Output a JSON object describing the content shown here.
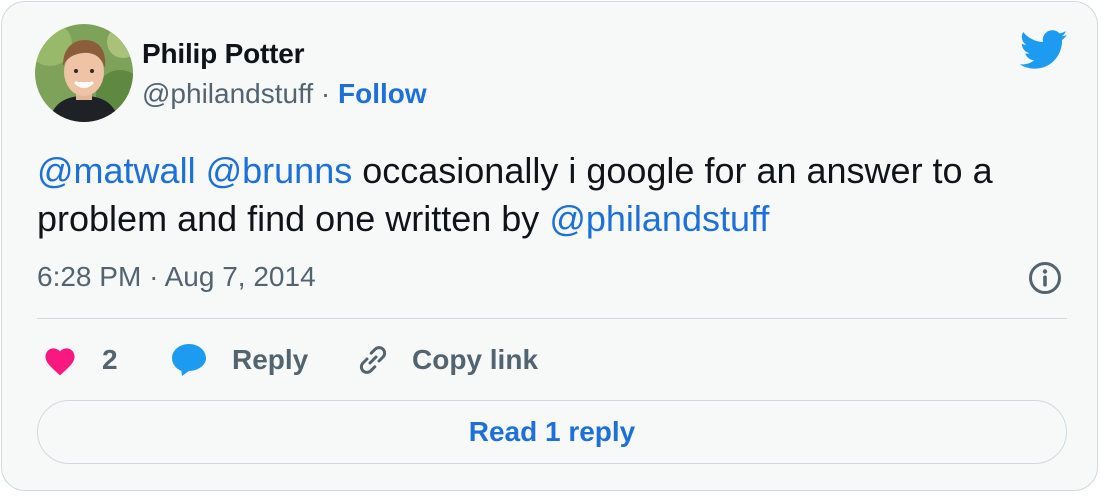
{
  "author": {
    "name": "Philip Potter",
    "handle": "@philandstuff",
    "separator": "·",
    "follow_label": "Follow"
  },
  "tweet": {
    "mention_1": "@matwall",
    "mention_2": "@brunns",
    "text_part_1": "occasionally i google for an answer to a problem and find one written by",
    "mention_3": "@philandstuff"
  },
  "meta": {
    "time": "6:28 PM",
    "separator": "·",
    "date": "Aug 7, 2014"
  },
  "actions": {
    "like_count": "2",
    "reply_label": "Reply",
    "copy_link_label": "Copy link"
  },
  "read_replies_label": "Read 1 reply",
  "icons": {
    "brand": "twitter-bird-icon",
    "info": "info-icon",
    "like": "heart-icon",
    "reply": "speech-bubble-icon",
    "copy": "link-icon"
  },
  "colors": {
    "accent": "#1d70d8",
    "like": "#f91880",
    "twitter_blue": "#1d9bf0",
    "muted": "#536471",
    "text": "#0f1419",
    "background": "#f7f9f9",
    "border": "#cfd9de"
  }
}
